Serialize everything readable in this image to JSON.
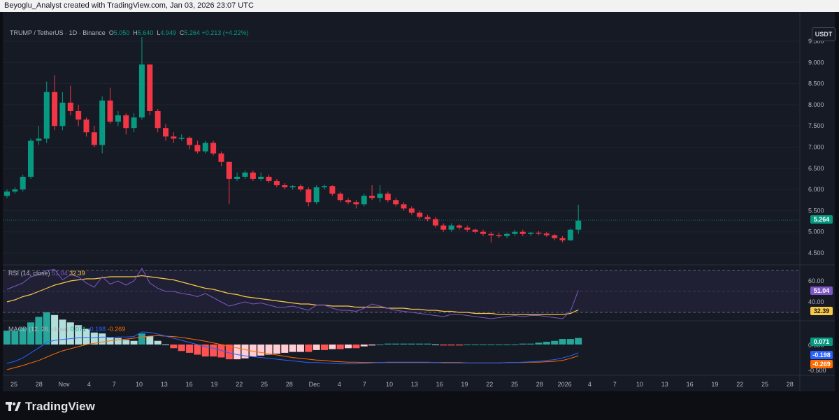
{
  "header": {
    "caption": "Beyoglu_Analyst created with TradingView.com, Jan 03, 2026 23:07 UTC"
  },
  "symbol": {
    "name": "TRUMP / TetherUS · 1D · Binance",
    "open_label": "O",
    "open": "5.050",
    "high_label": "H",
    "high": "5.640",
    "low_label": "L",
    "low": "4.949",
    "close_label": "C",
    "close": "5.264",
    "change": "+0.213 (+4.22%)"
  },
  "currency_button": "USDT",
  "price_axis": [
    "9.500",
    "9.000",
    "8.500",
    "8.000",
    "7.500",
    "7.000",
    "6.500",
    "6.000",
    "5.500",
    "5.000",
    "4.500"
  ],
  "last_price": "5.264",
  "rsi": {
    "title": "RSI (14, close)",
    "value": "51.04",
    "ma": "32.39",
    "axis": [
      "60.00",
      "40.00"
    ],
    "tag_value": "51.04",
    "tag_ma": "32.39"
  },
  "macd": {
    "title": "MACD (12, 26, close)",
    "hist": "0.071",
    "macd": "-0.198",
    "signal": "-0.269",
    "axis": [
      "0.000",
      "-0.500"
    ],
    "tag_hist": "0.071",
    "tag_macd": "-0.198",
    "tag_signal": "-0.269"
  },
  "time_axis": [
    "25",
    "28",
    "Nov",
    "4",
    "7",
    "10",
    "13",
    "16",
    "19",
    "22",
    "25",
    "28",
    "Dec",
    "4",
    "7",
    "10",
    "13",
    "16",
    "19",
    "22",
    "25",
    "28",
    "2026",
    "4",
    "7",
    "10",
    "13",
    "16",
    "19",
    "22",
    "25",
    "28"
  ],
  "footer": {
    "brand": "TradingView"
  },
  "colors": {
    "up": "#089981",
    "down": "#f23645",
    "rsi": "#7e57c2",
    "rsi_ma": "#f7c948",
    "macd": "#2962ff",
    "signal": "#ff6d00"
  },
  "chart_data": {
    "type": "candlestick",
    "price_range": [
      4.2,
      9.9
    ],
    "candles": [
      {
        "o": 5.85,
        "h": 6.0,
        "l": 5.8,
        "c": 5.95
      },
      {
        "o": 5.95,
        "h": 6.05,
        "l": 5.9,
        "c": 6.0
      },
      {
        "o": 6.0,
        "h": 6.35,
        "l": 5.95,
        "c": 6.3
      },
      {
        "o": 6.3,
        "h": 7.2,
        "l": 6.25,
        "c": 7.15
      },
      {
        "o": 7.15,
        "h": 7.5,
        "l": 7.05,
        "c": 7.2
      },
      {
        "o": 7.2,
        "h": 8.55,
        "l": 7.1,
        "c": 8.3
      },
      {
        "o": 8.3,
        "h": 8.7,
        "l": 7.4,
        "c": 7.5
      },
      {
        "o": 7.5,
        "h": 8.3,
        "l": 7.4,
        "c": 8.05
      },
      {
        "o": 8.05,
        "h": 8.45,
        "l": 7.75,
        "c": 7.85
      },
      {
        "o": 7.85,
        "h": 8.0,
        "l": 7.5,
        "c": 7.65
      },
      {
        "o": 7.65,
        "h": 7.7,
        "l": 7.25,
        "c": 7.35
      },
      {
        "o": 7.35,
        "h": 7.5,
        "l": 7.0,
        "c": 7.05
      },
      {
        "o": 7.05,
        "h": 8.2,
        "l": 6.85,
        "c": 8.1
      },
      {
        "o": 8.1,
        "h": 8.4,
        "l": 7.55,
        "c": 7.6
      },
      {
        "o": 7.6,
        "h": 7.85,
        "l": 7.5,
        "c": 7.75
      },
      {
        "o": 7.75,
        "h": 7.8,
        "l": 7.3,
        "c": 7.45
      },
      {
        "o": 7.45,
        "h": 7.8,
        "l": 7.35,
        "c": 7.7
      },
      {
        "o": 7.7,
        "h": 9.6,
        "l": 7.65,
        "c": 8.95
      },
      {
        "o": 8.95,
        "h": 8.95,
        "l": 7.75,
        "c": 7.85
      },
      {
        "o": 7.85,
        "h": 7.9,
        "l": 7.35,
        "c": 7.45
      },
      {
        "o": 7.45,
        "h": 7.55,
        "l": 7.15,
        "c": 7.25
      },
      {
        "o": 7.25,
        "h": 7.35,
        "l": 7.1,
        "c": 7.2
      },
      {
        "o": 7.2,
        "h": 7.3,
        "l": 7.15,
        "c": 7.22
      },
      {
        "o": 7.22,
        "h": 7.25,
        "l": 6.95,
        "c": 7.05
      },
      {
        "o": 7.05,
        "h": 7.15,
        "l": 6.85,
        "c": 6.9
      },
      {
        "o": 6.9,
        "h": 7.15,
        "l": 6.85,
        "c": 7.1
      },
      {
        "o": 7.1,
        "h": 7.15,
        "l": 6.8,
        "c": 6.85
      },
      {
        "o": 6.85,
        "h": 6.9,
        "l": 6.55,
        "c": 6.65
      },
      {
        "o": 6.65,
        "h": 6.65,
        "l": 5.65,
        "c": 6.25
      },
      {
        "o": 6.25,
        "h": 6.4,
        "l": 6.2,
        "c": 6.3
      },
      {
        "o": 6.3,
        "h": 6.45,
        "l": 6.25,
        "c": 6.4
      },
      {
        "o": 6.4,
        "h": 6.45,
        "l": 6.2,
        "c": 6.25
      },
      {
        "o": 6.25,
        "h": 6.4,
        "l": 6.2,
        "c": 6.3
      },
      {
        "o": 6.3,
        "h": 6.35,
        "l": 6.15,
        "c": 6.2
      },
      {
        "o": 6.2,
        "h": 6.25,
        "l": 6.05,
        "c": 6.1
      },
      {
        "o": 6.1,
        "h": 6.15,
        "l": 6.0,
        "c": 6.05
      },
      {
        "o": 6.05,
        "h": 6.1,
        "l": 6.0,
        "c": 6.08
      },
      {
        "o": 6.08,
        "h": 6.12,
        "l": 5.95,
        "c": 6.0
      },
      {
        "o": 6.0,
        "h": 6.05,
        "l": 5.6,
        "c": 5.7
      },
      {
        "o": 5.7,
        "h": 6.1,
        "l": 5.65,
        "c": 6.05
      },
      {
        "o": 6.05,
        "h": 6.12,
        "l": 6.0,
        "c": 6.08
      },
      {
        "o": 6.08,
        "h": 6.1,
        "l": 5.85,
        "c": 5.9
      },
      {
        "o": 5.9,
        "h": 5.95,
        "l": 5.7,
        "c": 5.75
      },
      {
        "o": 5.75,
        "h": 5.8,
        "l": 5.65,
        "c": 5.7
      },
      {
        "o": 5.7,
        "h": 5.75,
        "l": 5.55,
        "c": 5.65
      },
      {
        "o": 5.65,
        "h": 5.9,
        "l": 5.6,
        "c": 5.85
      },
      {
        "o": 5.85,
        "h": 6.1,
        "l": 5.75,
        "c": 5.8
      },
      {
        "o": 5.8,
        "h": 6.1,
        "l": 5.7,
        "c": 5.9
      },
      {
        "o": 5.9,
        "h": 5.95,
        "l": 5.7,
        "c": 5.75
      },
      {
        "o": 5.75,
        "h": 5.8,
        "l": 5.6,
        "c": 5.65
      },
      {
        "o": 5.65,
        "h": 5.7,
        "l": 5.5,
        "c": 5.55
      },
      {
        "o": 5.55,
        "h": 5.6,
        "l": 5.4,
        "c": 5.45
      },
      {
        "o": 5.45,
        "h": 5.5,
        "l": 5.3,
        "c": 5.35
      },
      {
        "o": 5.35,
        "h": 5.4,
        "l": 5.25,
        "c": 5.3
      },
      {
        "o": 5.3,
        "h": 5.35,
        "l": 5.1,
        "c": 5.15
      },
      {
        "o": 5.15,
        "h": 5.2,
        "l": 5.0,
        "c": 5.05
      },
      {
        "o": 5.05,
        "h": 5.2,
        "l": 5.0,
        "c": 5.15
      },
      {
        "o": 5.15,
        "h": 5.18,
        "l": 5.05,
        "c": 5.1
      },
      {
        "o": 5.1,
        "h": 5.15,
        "l": 5.0,
        "c": 5.05
      },
      {
        "o": 5.05,
        "h": 5.08,
        "l": 4.95,
        "c": 5.0
      },
      {
        "o": 5.0,
        "h": 5.05,
        "l": 4.9,
        "c": 4.95
      },
      {
        "o": 4.95,
        "h": 5.0,
        "l": 4.75,
        "c": 4.92
      },
      {
        "o": 4.92,
        "h": 4.98,
        "l": 4.85,
        "c": 4.9
      },
      {
        "o": 4.9,
        "h": 4.98,
        "l": 4.85,
        "c": 4.95
      },
      {
        "o": 4.95,
        "h": 5.05,
        "l": 4.9,
        "c": 5.0
      },
      {
        "o": 5.0,
        "h": 5.05,
        "l": 4.9,
        "c": 4.95
      },
      {
        "o": 4.95,
        "h": 5.0,
        "l": 4.9,
        "c": 4.98
      },
      {
        "o": 4.98,
        "h": 5.02,
        "l": 4.92,
        "c": 4.96
      },
      {
        "o": 4.96,
        "h": 5.0,
        "l": 4.88,
        "c": 4.92
      },
      {
        "o": 4.92,
        "h": 4.95,
        "l": 4.8,
        "c": 4.85
      },
      {
        "o": 4.85,
        "h": 4.9,
        "l": 4.75,
        "c": 4.8
      },
      {
        "o": 4.8,
        "h": 5.08,
        "l": 4.78,
        "c": 5.05
      },
      {
        "o": 5.05,
        "h": 5.64,
        "l": 4.949,
        "c": 5.264
      }
    ],
    "rsi_values": [
      52,
      55,
      58,
      64,
      66,
      70,
      71,
      61,
      66,
      64,
      58,
      54,
      64,
      57,
      60,
      56,
      60,
      72,
      58,
      53,
      50,
      50,
      48,
      47,
      45,
      48,
      44,
      40,
      36,
      38,
      40,
      38,
      39,
      37,
      35,
      35,
      36,
      34,
      32,
      37,
      37,
      34,
      32,
      32,
      31,
      34,
      38,
      36,
      34,
      32,
      31,
      30,
      29,
      28,
      27,
      26,
      28,
      28,
      27,
      26,
      25,
      24,
      25,
      26,
      27,
      26,
      27,
      27,
      26,
      25,
      24,
      31,
      51.04
    ],
    "rsi_ma_values": [
      40,
      42,
      45,
      47,
      50,
      53,
      56,
      58,
      60,
      61,
      62,
      62,
      63,
      64,
      64,
      64,
      64,
      65,
      64,
      63,
      62,
      61,
      59,
      57,
      55,
      53,
      52,
      50,
      48,
      47,
      45,
      44,
      43,
      42,
      41,
      40,
      39,
      38,
      38,
      37,
      37,
      36,
      36,
      36,
      35,
      35,
      35,
      35,
      34,
      34,
      34,
      33,
      33,
      32,
      32,
      31,
      31,
      30,
      30,
      29,
      29,
      29,
      28,
      28,
      28,
      28,
      28,
      28,
      28,
      28,
      28,
      29,
      32.39
    ],
    "macd_values": [
      -0.45,
      -0.4,
      -0.32,
      -0.2,
      -0.08,
      0.05,
      0.1,
      0.12,
      0.14,
      0.16,
      0.17,
      0.16,
      0.18,
      0.17,
      0.18,
      0.18,
      0.19,
      0.3,
      0.29,
      0.25,
      0.2,
      0.15,
      0.1,
      0.05,
      0.0,
      -0.05,
      -0.09,
      -0.14,
      -0.2,
      -0.24,
      -0.27,
      -0.29,
      -0.31,
      -0.33,
      -0.35,
      -0.37,
      -0.39,
      -0.41,
      -0.43,
      -0.43,
      -0.44,
      -0.45,
      -0.46,
      -0.46,
      -0.46,
      -0.45,
      -0.44,
      -0.43,
      -0.42,
      -0.42,
      -0.42,
      -0.42,
      -0.42,
      -0.42,
      -0.43,
      -0.44,
      -0.44,
      -0.44,
      -0.44,
      -0.44,
      -0.44,
      -0.44,
      -0.44,
      -0.43,
      -0.43,
      -0.42,
      -0.41,
      -0.4,
      -0.38,
      -0.36,
      -0.32,
      -0.27,
      -0.198
    ],
    "signal_values": [
      -0.6,
      -0.55,
      -0.5,
      -0.44,
      -0.38,
      -0.3,
      -0.22,
      -0.15,
      -0.1,
      -0.05,
      0.0,
      0.03,
      0.06,
      0.09,
      0.11,
      0.13,
      0.15,
      0.18,
      0.2,
      0.21,
      0.2,
      0.19,
      0.17,
      0.14,
      0.11,
      0.08,
      0.04,
      0.0,
      -0.04,
      -0.08,
      -0.12,
      -0.16,
      -0.19,
      -0.22,
      -0.25,
      -0.28,
      -0.31,
      -0.33,
      -0.35,
      -0.37,
      -0.38,
      -0.4,
      -0.41,
      -0.42,
      -0.42,
      -0.43,
      -0.43,
      -0.43,
      -0.43,
      -0.43,
      -0.43,
      -0.43,
      -0.43,
      -0.43,
      -0.43,
      -0.43,
      -0.43,
      -0.43,
      -0.44,
      -0.44,
      -0.44,
      -0.44,
      -0.44,
      -0.43,
      -0.43,
      -0.43,
      -0.42,
      -0.42,
      -0.41,
      -0.4,
      -0.38,
      -0.33,
      -0.269
    ]
  }
}
